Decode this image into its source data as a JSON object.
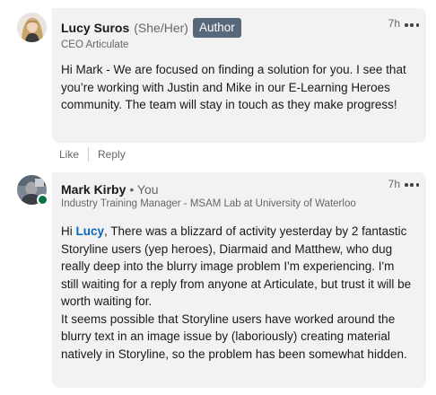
{
  "comments": [
    {
      "author_name": "Lucy Suros",
      "pronouns": "(She/Her)",
      "badge": "Author",
      "headline": "CEO Articulate",
      "time": "7h",
      "body": "Hi Mark - We are focused on finding a solution for you. I see that you’re working with Justin and Mike in our E-Learning Heroes community. The team will stay in touch as they make progress!",
      "actions": {
        "like": "Like",
        "reply": "Reply"
      }
    },
    {
      "author_name": "Mark Kirby",
      "you_tag": "• You",
      "headline": "Industry Training Manager - MSAM Lab at University of Waterloo",
      "time": "7h",
      "body_greeting": "Hi ",
      "body_mention": "Lucy",
      "body_para1_rest": ", There was a blizzard of activity yesterday by 2 fantastic Storyline users (yep heroes), Diarmaid and Matthew, who dug really deep into the blurry image problem I'm experiencing. I'm still waiting for a reply from anyone at Articulate, but trust it will be worth waiting for.",
      "body_para2": "It seems possible that Storyline users have worked around the blurry text in an image issue by (laboriously) creating material natively in Storyline, so the problem has been somewhat hidden."
    }
  ],
  "colors": {
    "bubble": "#f2f2f2",
    "mention": "#0a66c2",
    "author_badge": "#56687a",
    "online_status": "#057642"
  },
  "icons": [
    "more-options-icon",
    "avatar",
    "online-status-icon"
  ]
}
